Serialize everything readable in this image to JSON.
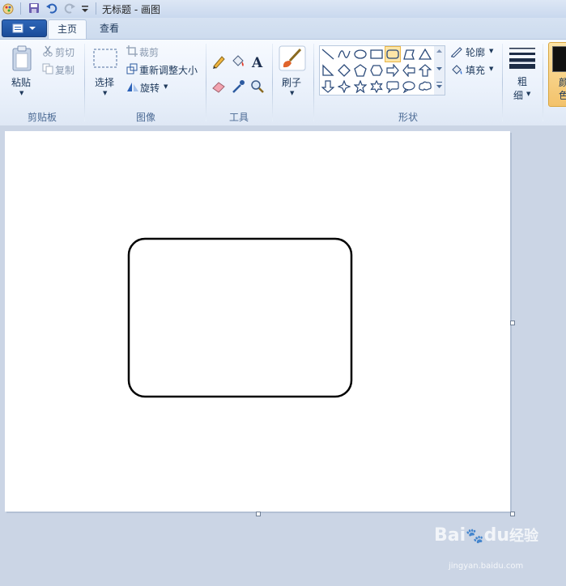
{
  "title_bar": {
    "title": "无标题 - 画图"
  },
  "tabs": {
    "home": "主页",
    "view": "查看"
  },
  "clipboard": {
    "paste": "粘贴",
    "cut": "剪切",
    "copy": "复制",
    "group": "剪贴板"
  },
  "image": {
    "select": "选择",
    "crop": "裁剪",
    "resize": "重新调整大小",
    "rotate": "旋转",
    "group": "图像"
  },
  "tools": {
    "group": "工具"
  },
  "brush": {
    "label": "刷子"
  },
  "shapes": {
    "outline": "轮廓",
    "fill": "填充",
    "group": "形状"
  },
  "size": {
    "label_line1": "粗",
    "label_line2": "细"
  },
  "colors": {
    "label_line1": "颜",
    "label_line2": "色",
    "color1": "#111111",
    "accent": "#f3c26b"
  },
  "watermark": {
    "brand": "Bai",
    "brand2": "du",
    "brand3": "经验",
    "url": "jingyan.baidu.com"
  }
}
